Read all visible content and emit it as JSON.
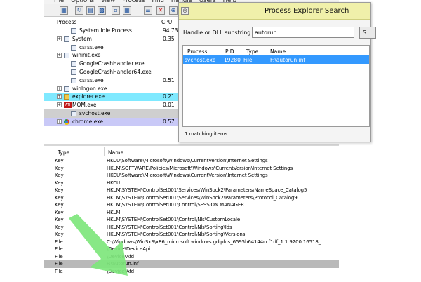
{
  "menu": [
    "File",
    "Options",
    "View",
    "Process",
    "Find",
    "Handle",
    "Users",
    "Help"
  ],
  "toolbar_icons": [
    "save-icon",
    "refresh-icon",
    "system-info-icon",
    "cpu-graph-icon",
    "window-icon",
    "find-icon",
    "kill-icon",
    "target-icon",
    "binoculars-icon"
  ],
  "process_list": {
    "col_process": "Process",
    "col_cpu": "CPU",
    "rows": [
      {
        "name": "System Idle Process",
        "cpu": "94.73",
        "expand": "",
        "icon": "process-icon",
        "highlight": "",
        "indent": 1
      },
      {
        "name": "System",
        "cpu": "0.35",
        "expand": "+",
        "icon": "process-icon",
        "highlight": "",
        "indent": 0
      },
      {
        "name": "csrss.exe",
        "cpu": "",
        "expand": "",
        "icon": "process-icon",
        "highlight": "",
        "indent": 1
      },
      {
        "name": "wininit.exe",
        "cpu": "",
        "expand": "+",
        "icon": "process-icon",
        "highlight": "",
        "indent": 0
      },
      {
        "name": "GoogleCrashHandler.exe",
        "cpu": "",
        "expand": "",
        "icon": "process-icon",
        "highlight": "",
        "indent": 1
      },
      {
        "name": "GoogleCrashHandler64.exe",
        "cpu": "",
        "expand": "",
        "icon": "process-icon",
        "highlight": "",
        "indent": 1
      },
      {
        "name": "csrss.exe",
        "cpu": "0.51",
        "expand": "",
        "icon": "process-icon",
        "highlight": "",
        "indent": 1
      },
      {
        "name": "winlogon.exe",
        "cpu": "",
        "expand": "+",
        "icon": "process-icon",
        "highlight": "",
        "indent": 0
      },
      {
        "name": "explorer.exe",
        "cpu": "0.21",
        "expand": "+",
        "icon": "folder-icon",
        "highlight": "cyan",
        "indent": 0
      },
      {
        "name": "MOM.exe",
        "cpu": "0.01",
        "expand": "+",
        "icon": "ati-icon",
        "highlight": "",
        "indent": 0
      },
      {
        "name": "svchost.exe",
        "cpu": "",
        "expand": "",
        "icon": "process-icon",
        "highlight": "gray",
        "indent": 1
      },
      {
        "name": "chrome.exe",
        "cpu": "0.57",
        "expand": "+",
        "icon": "chrome-icon",
        "highlight": "lavender",
        "indent": 0
      }
    ]
  },
  "handles": {
    "col_type": "Type",
    "col_name": "Name",
    "rows": [
      {
        "type": "Key",
        "name": "HKCU\\Software\\Microsoft\\Windows\\CurrentVersion\\Internet Settings",
        "selected": false
      },
      {
        "type": "Key",
        "name": "HKLM\\SOFTWARE\\Policies\\Microsoft\\Windows\\CurrentVersion\\Internet Settings",
        "selected": false
      },
      {
        "type": "Key",
        "name": "HKCU\\Software\\Microsoft\\Windows\\CurrentVersion\\Internet Settings",
        "selected": false
      },
      {
        "type": "Key",
        "name": "HKCU",
        "selected": false
      },
      {
        "type": "Key",
        "name": "HKLM\\SYSTEM\\ControlSet001\\Services\\WinSock2\\Parameters\\NameSpace_Catalog5",
        "selected": false
      },
      {
        "type": "Key",
        "name": "HKLM\\SYSTEM\\ControlSet001\\Services\\WinSock2\\Parameters\\Protocol_Catalog9",
        "selected": false
      },
      {
        "type": "Key",
        "name": "HKLM\\SYSTEM\\ControlSet001\\Control\\SESSION MANAGER",
        "selected": false
      },
      {
        "type": "Key",
        "name": "HKLM",
        "selected": false
      },
      {
        "type": "Key",
        "name": "HKLM\\SYSTEM\\ControlSet001\\Control\\Nls\\CustomLocale",
        "selected": false
      },
      {
        "type": "Key",
        "name": "HKLM\\SYSTEM\\ControlSet001\\Control\\Nls\\Sorting\\Ids",
        "selected": false
      },
      {
        "type": "Key",
        "name": "HKLM\\SYSTEM\\ControlSet001\\Control\\Nls\\Sorting\\Versions",
        "selected": false
      },
      {
        "type": "File",
        "name": "C:\\Windows\\WinSxS\\x86_microsoft.windows.gdiplus_6595b64144ccf1df_1.1.9200.16518_...",
        "selected": false
      },
      {
        "type": "File",
        "name": "\\Device\\DeviceApi",
        "selected": false
      },
      {
        "type": "File",
        "name": "\\Device\\Afd",
        "selected": false
      },
      {
        "type": "File",
        "name": "F:\\autorun.inf",
        "selected": true
      },
      {
        "type": "File",
        "name": "\\Device\\Afd",
        "selected": false
      }
    ]
  },
  "search_dialog": {
    "title": "Process Explorer Search",
    "label": "Handle or DLL substring:",
    "input_value": "autorun",
    "button_label": "S",
    "columns": {
      "process": "Process",
      "pid": "PID",
      "type": "Type",
      "name": "Name"
    },
    "result": {
      "process": "svchost.exe",
      "pid": "19280",
      "type": "File",
      "name": "F:\\autorun.inf"
    },
    "status": "1 matching items."
  },
  "colors": {
    "cyan_highlight": "#7fe9ff",
    "gray_highlight": "#cfcfcf",
    "lavender_highlight": "#c9c9f7",
    "dialog_title": "#f0f0aa",
    "result_selection": "#3399ff",
    "arrow": "#7ee67c"
  }
}
